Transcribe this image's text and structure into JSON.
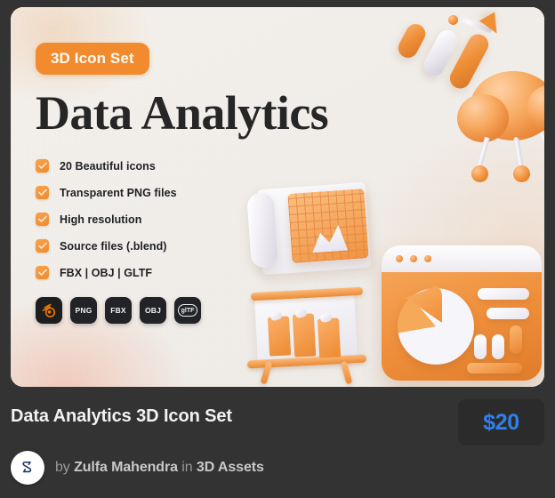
{
  "card": {
    "badge_label": "3D Icon Set",
    "hero_title": "Data Analytics",
    "features": [
      {
        "label": "20 Beautiful icons",
        "icon": "check-icon"
      },
      {
        "label": "Transparent PNG files",
        "icon": "check-icon"
      },
      {
        "label": "High resolution",
        "icon": "check-icon"
      },
      {
        "label": "Source files (.blend)",
        "icon": "check-icon"
      },
      {
        "label": "FBX | OBJ | GLTF",
        "icon": "check-icon"
      }
    ],
    "formats": [
      {
        "label": "",
        "icon": "blender-logo-icon",
        "type": "blender"
      },
      {
        "label": "PNG",
        "icon": "png-format-icon",
        "type": "text"
      },
      {
        "label": "FBX",
        "icon": "fbx-format-icon",
        "type": "text"
      },
      {
        "label": "OBJ",
        "icon": "obj-format-icon",
        "type": "text"
      },
      {
        "label": "glTF",
        "icon": "gltf-format-icon",
        "type": "gltf"
      }
    ],
    "artwork": {
      "description": "3D data analytics illustrations",
      "items": [
        "dashboard-window-icon",
        "pie-chart-icon",
        "rolled-chart-scroll-icon",
        "presentation-easel-bar-chart-icon",
        "orange-cloud-connector-icon",
        "cylinder-bars-icon",
        "arrow-icon"
      ]
    }
  },
  "meta": {
    "product_title": "Data Analytics 3D Icon Set",
    "price": "$20",
    "byline_prefix": "by",
    "author": "Zulfa Mahendra",
    "byline_middle": "in",
    "category": "3D Assets",
    "avatar_icon": "author-avatar-logo"
  },
  "colors": {
    "accent_orange": "#f28b2e",
    "price_blue": "#2f80ed",
    "frame_dark": "#333333",
    "card_bg": "#f1efed",
    "badge_dark": "#222326"
  }
}
